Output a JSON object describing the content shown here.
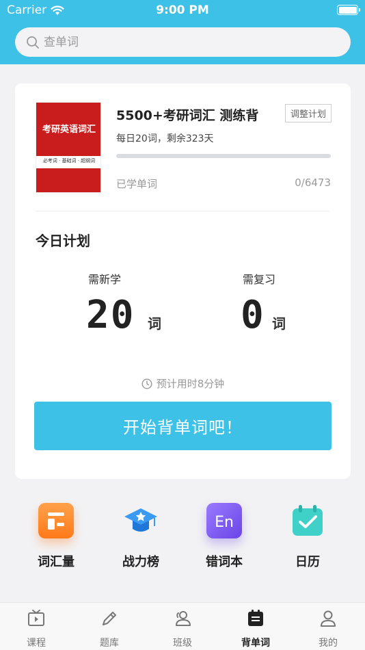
{
  "status_bar": {
    "carrier": "Carrier",
    "time": "9:00 PM"
  },
  "search": {
    "placeholder": "查单词"
  },
  "book": {
    "cover_title": "考研英语词汇",
    "cover_subtitle": "必考词 · 基础词 · 超纲词",
    "title": "5500+考研词汇 测练背",
    "adjust_label": "调整计划",
    "plan": "每日20词，剩余323天",
    "progress": 0,
    "learned_label": "已学单词",
    "learned_count": "0/6473"
  },
  "today": {
    "title": "今日计划",
    "new_label": "需新学",
    "new_value": "20",
    "review_label": "需复习",
    "review_value": "0",
    "unit": "词",
    "estimate": "预计用时8分钟",
    "start_label": "开始背单词吧！"
  },
  "features": [
    {
      "label": "词汇量",
      "icon": "vocabulary-icon",
      "color": "#ff8a2a"
    },
    {
      "label": "战力榜",
      "icon": "graduation-cap-icon",
      "color": "#2b8be8"
    },
    {
      "label": "错词本",
      "icon": "en-book-icon",
      "color": "#7b5cf0"
    },
    {
      "label": "日历",
      "icon": "calendar-check-icon",
      "color": "#3fd0c8"
    }
  ],
  "tabs": [
    {
      "label": "课程",
      "icon": "tv-play-icon",
      "active": false
    },
    {
      "label": "题库",
      "icon": "pencil-icon",
      "active": false
    },
    {
      "label": "班级",
      "icon": "users-icon",
      "active": false
    },
    {
      "label": "背单词",
      "icon": "calendar-list-icon",
      "active": true
    },
    {
      "label": "我的",
      "icon": "user-icon",
      "active": false
    }
  ],
  "colors": {
    "primary": "#3dc1e6",
    "cover_red": "#c91d1d"
  }
}
